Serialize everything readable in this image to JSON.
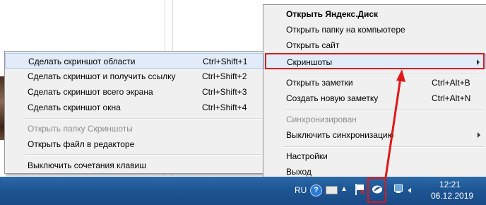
{
  "main_menu": {
    "items": [
      {
        "label": "Открыть Яндекс.Диск",
        "bold": true
      },
      {
        "label": "Открыть папку на компьютере"
      },
      {
        "label": "Открыть сайт"
      },
      {
        "label": "Скриншоты"
      },
      {
        "label": "Открыть заметки",
        "shortcut": "Ctrl+Alt+B"
      },
      {
        "label": "Создать новую заметку",
        "shortcut": "Ctrl+Alt+N"
      },
      {
        "label": "Синхронизирован",
        "disabled": true
      },
      {
        "label": "Выключить синхронизацию"
      },
      {
        "label": "Настройки"
      },
      {
        "label": "Выход"
      }
    ]
  },
  "submenu": {
    "items": [
      {
        "label": "Сделать скриншот области",
        "shortcut": "Ctrl+Shift+1"
      },
      {
        "label": "Сделать скриншот и получить ссылку",
        "shortcut": "Ctrl+Shift+2"
      },
      {
        "label": "Сделать скриншот всего экрана",
        "shortcut": "Ctrl+Shift+3"
      },
      {
        "label": "Сделать скриншот окна",
        "shortcut": "Ctrl+Shift+4"
      },
      {
        "label": "Открыть папку Скриншоты",
        "disabled": true
      },
      {
        "label": "Открыть файл в редакторе"
      },
      {
        "label": "Выключить сочетания клавиш"
      }
    ]
  },
  "taskbar": {
    "language": "RU",
    "help_glyph": "?",
    "clock_time": "12:21",
    "clock_date": "06.12.2019"
  },
  "colors": {
    "highlight_outline": "#e01818",
    "taskbar": "#1e5796",
    "menu_bg": "#f0f0f0"
  }
}
